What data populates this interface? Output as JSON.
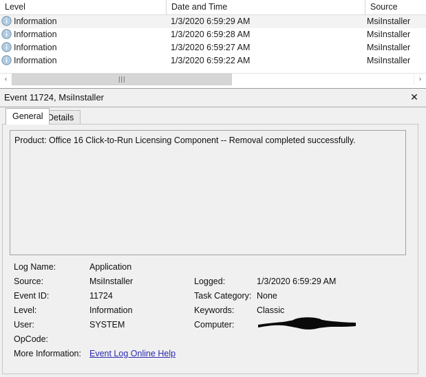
{
  "event_list": {
    "columns": [
      {
        "key": "level",
        "label": "Level"
      },
      {
        "key": "date",
        "label": "Date and Time"
      },
      {
        "key": "source",
        "label": "Source"
      }
    ],
    "rows": [
      {
        "icon": "information-icon",
        "level": "Information",
        "date": "1/3/2020 6:59:29 AM",
        "source": "MsiInstaller",
        "selected": true
      },
      {
        "icon": "information-icon",
        "level": "Information",
        "date": "1/3/2020 6:59:28 AM",
        "source": "MsiInstaller",
        "selected": false
      },
      {
        "icon": "information-icon",
        "level": "Information",
        "date": "1/3/2020 6:59:27 AM",
        "source": "MsiInstaller",
        "selected": false
      },
      {
        "icon": "information-icon",
        "level": "Information",
        "date": "1/3/2020 6:59:22 AM",
        "source": "MsiInstaller",
        "selected": false
      }
    ],
    "scrollbar": {
      "left_arrow": "‹",
      "right_arrow": "›",
      "grip": "|||"
    }
  },
  "detail": {
    "title": "Event 11724, MsiInstaller",
    "close_label": "✕",
    "tabs": [
      {
        "label": "General",
        "active": true
      },
      {
        "label": "Details",
        "active": false
      }
    ],
    "message": "Product: Office 16 Click-to-Run Licensing Component -- Removal completed successfully.",
    "fields": {
      "log_name_label": "Log Name:",
      "log_name_value": "Application",
      "source_label": "Source:",
      "source_value": "MsiInstaller",
      "event_id_label": "Event ID:",
      "event_id_value": "11724",
      "level_label": "Level:",
      "level_value": "Information",
      "user_label": "User:",
      "user_value": "SYSTEM",
      "opcode_label": "OpCode:",
      "opcode_value": "",
      "logged_label": "Logged:",
      "logged_value": "1/3/2020 6:59:29 AM",
      "task_category_label": "Task Category:",
      "task_category_value": "None",
      "keywords_label": "Keywords:",
      "keywords_value": "Classic",
      "computer_label": "Computer:",
      "computer_value": "",
      "more_information_label": "More Information:",
      "more_information_link": "Event Log Online Help"
    }
  },
  "colors": {
    "link": "#2a2ab0",
    "pane_bg": "#f0f0f0",
    "selected_row": "#f3f3f3",
    "info_icon": "#7aa8cc",
    "redaction": "#000000"
  }
}
